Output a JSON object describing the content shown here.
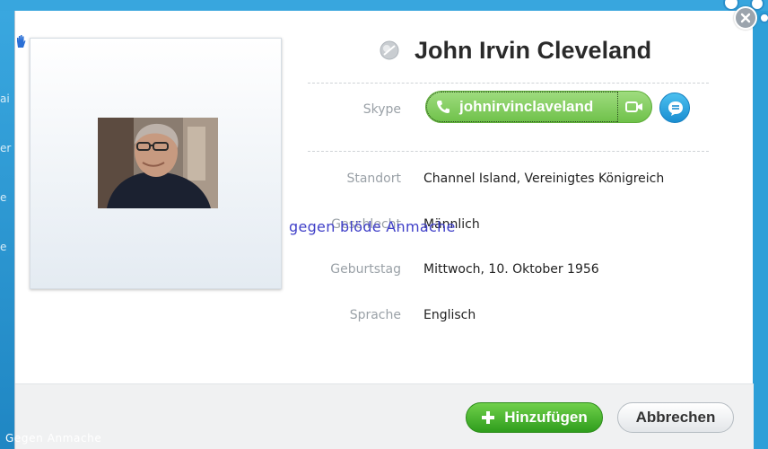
{
  "profile": {
    "name": "John Irvin Cleveland",
    "skype_label": "Skype",
    "skype_id": "johnirvinclaveland"
  },
  "details": [
    {
      "label": "Standort",
      "value": "Channel Island, Vereinigtes Königreich"
    },
    {
      "label": "Geschlecht",
      "value": "Männlich"
    },
    {
      "label": "Geburtstag",
      "value": "Mittwoch, 10. Oktober 1956"
    },
    {
      "label": "Sprache",
      "value": "Englisch"
    }
  ],
  "buttons": {
    "add_label": "Hinzufügen",
    "cancel_label": "Abbrechen"
  },
  "watermarks": {
    "center": "gegen blöde Anmache",
    "bottom": "Gegen Anmache"
  },
  "background_letters": [
    "ai",
    "er",
    "e",
    "e"
  ],
  "icons": {
    "status": "offline-status-icon",
    "call": "phone-icon",
    "video": "video-icon",
    "chat": "chat-icon",
    "add": "plus-icon",
    "close": "close-icon",
    "hand": "hand-icon"
  },
  "colors": {
    "skype_green": "#7bc95a",
    "chat_blue": "#2aa5e3",
    "add_green": "#3aa825",
    "background_blue": "#2d9fd8"
  }
}
